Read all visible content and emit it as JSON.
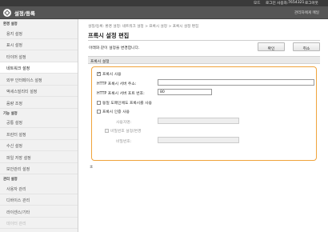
{
  "topbar": {
    "mode": "모드",
    "login_user_label": "로그인 사용자:",
    "login_user_id": "7654321",
    "logout": "로그아웃"
  },
  "header": {
    "title": "설정/등록",
    "admin_mode": "관리자에게 메일"
  },
  "sidebar": {
    "sections": [
      {
        "label": "환경 설정",
        "items": [
          "용지 설정",
          "표시 설정",
          "타이머 설정",
          "네트워크 설정",
          "외부 인터페이스 설정",
          "액세스빌리티 설정",
          "음량 조정"
        ]
      },
      {
        "label": "기능 설정",
        "items": [
          "공통 설정",
          "프린터 설정",
          "수신 설정",
          "파일 저장 설정",
          "보안관리 설정"
        ]
      },
      {
        "label": "관리 설정",
        "items": [
          "사용자 관리",
          "디바이스 관리",
          "라이센스/기타",
          "데이터 관리"
        ]
      }
    ],
    "active_item": "네트워크 설정"
  },
  "main": {
    "breadcrumb": "설정/등록: 환경 설정: 네트워크 설정 > 프록시 설정 > 프록시 설정 편집",
    "page_title": "프록시 설정 편집",
    "note": "아래와 같이 설정을 변경합니다.",
    "ok_label": "확인",
    "cancel_label": "취소",
    "section_label": "프록시 설정",
    "use_proxy_label": "프록시 사용",
    "use_proxy_checked": true,
    "server_address_label": "HTTP 프록시 서버 주소:",
    "server_address_value": "",
    "server_port_label": "HTTP 프록시 서버 포트 번호:",
    "server_port_value": "80",
    "same_domain_label": "동일 도메인에도 프록시를 사용",
    "same_domain_checked": false,
    "auth_label": "프록시 인증 사용",
    "auth_checked": false,
    "username_label": "사용자명:",
    "set_password_label": "비밀번호 설정/변경",
    "password_label": "비밀번호:",
    "footnote": "±"
  }
}
